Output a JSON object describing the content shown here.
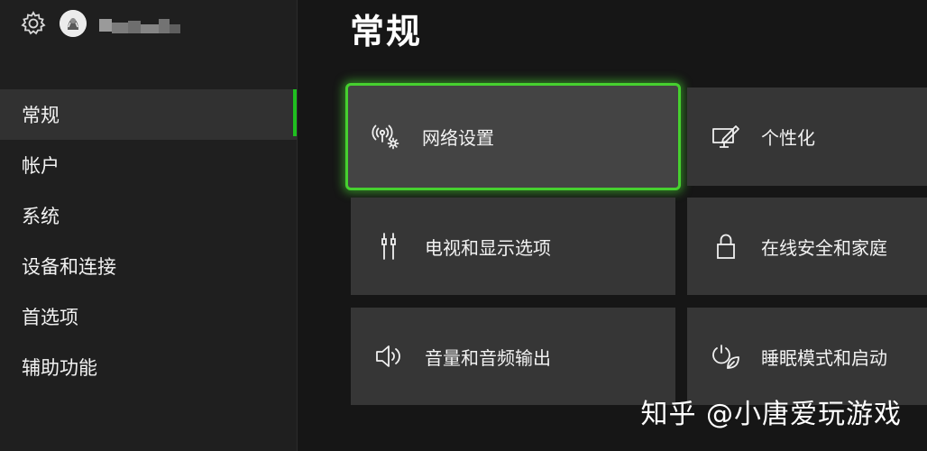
{
  "header": {
    "gamertag_redacted": true
  },
  "sidebar": {
    "items": [
      {
        "label": "常规",
        "active": true
      },
      {
        "label": "帐户",
        "active": false
      },
      {
        "label": "系统",
        "active": false
      },
      {
        "label": "设备和连接",
        "active": false
      },
      {
        "label": "首选项",
        "active": false
      },
      {
        "label": "辅助功能",
        "active": false
      }
    ]
  },
  "main": {
    "title": "常规",
    "tiles": [
      {
        "label": "网络设置",
        "icon": "network-settings-icon",
        "focused": true
      },
      {
        "label": "个性化",
        "icon": "personalize-icon",
        "focused": false
      },
      {
        "label": "电视和显示选项",
        "icon": "tv-display-icon",
        "focused": false
      },
      {
        "label": "在线安全和家庭",
        "icon": "lock-icon",
        "focused": false
      },
      {
        "label": "音量和音频输出",
        "icon": "speaker-icon",
        "focused": false
      },
      {
        "label": "睡眠模式和启动",
        "icon": "power-leaf-icon",
        "focused": false
      }
    ]
  },
  "watermark": {
    "text": "知乎 @小唐爱玩游戏"
  },
  "colors": {
    "accent": "#1fbf1f",
    "focus_border": "#46d02f",
    "sidebar_bg": "#1f1f1f",
    "main_bg": "#161616",
    "tile_bg": "#363636"
  }
}
